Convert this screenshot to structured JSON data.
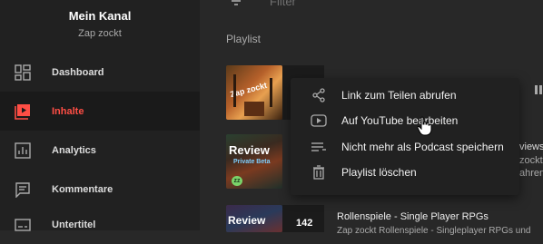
{
  "sidebar": {
    "channel_name": "Mein Kanal",
    "channel_sub": "Zap zockt",
    "items": [
      {
        "label": "Dashboard",
        "icon": "dashboard-icon"
      },
      {
        "label": "Inhalte",
        "icon": "content-icon",
        "active": true
      },
      {
        "label": "Analytics",
        "icon": "analytics-icon"
      },
      {
        "label": "Kommentare",
        "icon": "comments-icon"
      },
      {
        "label": "Untertitel",
        "icon": "subtitles-icon"
      }
    ]
  },
  "main": {
    "filter_placeholder": "Filter",
    "section_title": "Playlist",
    "playlists": [
      {
        "thumb_text": "Zap zockt"
      },
      {
        "thumb_text_top": "Review",
        "thumb_text_bottom": "Private Beta",
        "badge": "zz"
      },
      {
        "thumb_text": "Review",
        "count": "142",
        "title": "Rollenspiele - Single Player RPGs",
        "subtitle": "Zap zockt Rollenspiele - Singleplayer RPGs und"
      }
    ],
    "right_partial": [
      "views",
      "zockt",
      "ahren"
    ]
  },
  "context_menu": {
    "items": [
      {
        "label": "Link zum Teilen abrufen",
        "icon": "share-icon"
      },
      {
        "label": "Auf YouTube bearbeiten",
        "icon": "youtube-icon"
      },
      {
        "label": "Nicht mehr als Podcast speichern",
        "icon": "podcast-icon"
      },
      {
        "label": "Playlist löschen",
        "icon": "trash-icon"
      }
    ]
  },
  "colors": {
    "accent": "#ff4e45",
    "sidebar_bg": "#212121",
    "main_bg": "#282828"
  }
}
